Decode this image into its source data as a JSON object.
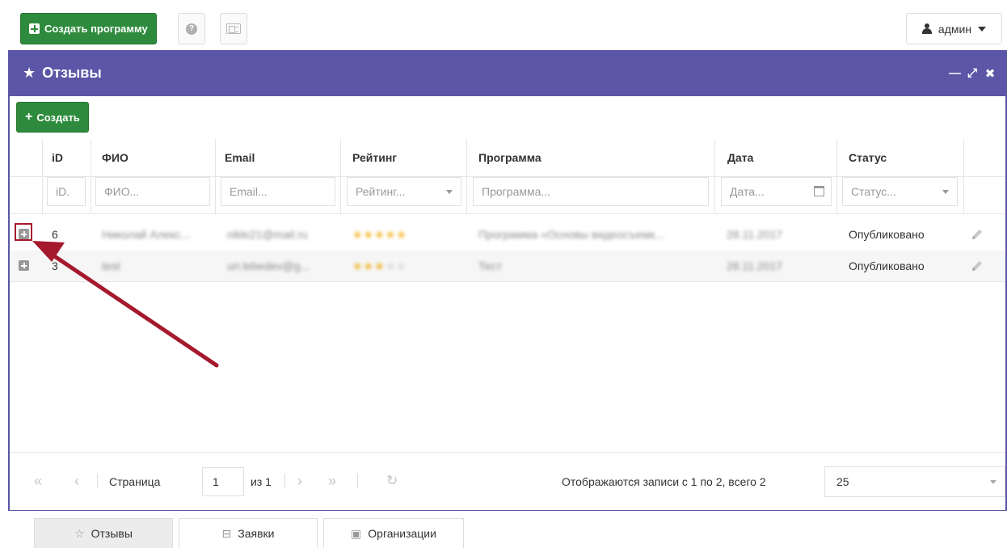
{
  "toolbar": {
    "create_program_label": "Создать программу",
    "user_label": "админ"
  },
  "panel": {
    "title": "Отзывы",
    "create_label": "Создать"
  },
  "grid": {
    "columns": [
      "iD",
      "ФИО",
      "Email",
      "Рейтинг",
      "Программа",
      "Дата",
      "Статус"
    ],
    "filters": {
      "id": "iD.",
      "fio": "ФИО...",
      "email": "Email...",
      "rating": "Рейтинг...",
      "program": "Программа...",
      "date": "Дата...",
      "status": "Статус..."
    },
    "rows": [
      {
        "id": "6",
        "fio": "Николай Алекс...",
        "email": "nikki21@mail.ru",
        "rating": 5,
        "program": "Программа «Основы видеосъемк...",
        "date": "28.11.2017",
        "status": "Опубликовано"
      },
      {
        "id": "3",
        "fio": "test",
        "email": "uri.lebedev@g...",
        "rating": 3,
        "program": "Тест",
        "date": "28.11.2017",
        "status": "Опубликовано"
      }
    ]
  },
  "pager": {
    "page_label": "Страница",
    "page_value": "1",
    "of_label": "из 1",
    "summary": "Отображаются записи с 1 по 2, всего 2",
    "page_size": "25"
  },
  "tabs": [
    {
      "label": "Отзывы",
      "icon": "star-icon",
      "active": true
    },
    {
      "label": "Заявки",
      "icon": "basket-icon",
      "active": false
    },
    {
      "label": "Организации",
      "icon": "briefcase-icon",
      "active": false
    }
  ],
  "colors": {
    "header_purple": "#5b56a6",
    "green_button": "#2e8b3d",
    "annotation_red": "#a5192d",
    "star_gold": "#f0b323"
  }
}
